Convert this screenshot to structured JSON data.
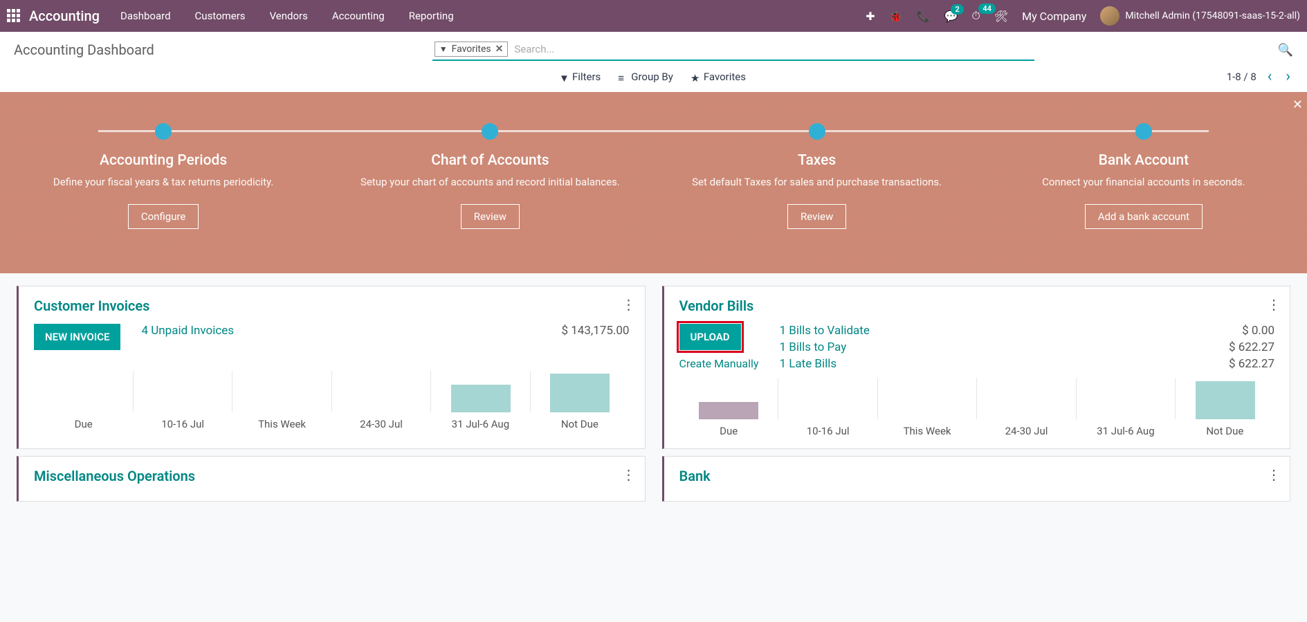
{
  "nav": {
    "brand": "Accounting",
    "menu": [
      "Dashboard",
      "Customers",
      "Vendors",
      "Accounting",
      "Reporting"
    ],
    "badges": {
      "chat": "2",
      "clock": "44"
    },
    "company": "My Company",
    "user": "Mitchell Admin (17548091-saas-15-2-all)"
  },
  "subheader": {
    "title": "Accounting Dashboard",
    "chip": "Favorites",
    "search_placeholder": "Search...",
    "filters": "Filters",
    "groupby": "Group By",
    "favorites": "Favorites",
    "pager": "1-8 / 8"
  },
  "hero": {
    "steps": [
      {
        "title": "Accounting Periods",
        "desc": "Define your fiscal years & tax returns periodicity.",
        "btn": "Configure"
      },
      {
        "title": "Chart of Accounts",
        "desc": "Setup your chart of accounts and record initial balances.",
        "btn": "Review"
      },
      {
        "title": "Taxes",
        "desc": "Set default Taxes for sales and purchase transactions.",
        "btn": "Review"
      },
      {
        "title": "Bank Account",
        "desc": "Connect your financial accounts in seconds.",
        "btn": "Add a bank account"
      }
    ]
  },
  "cards": {
    "invoices": {
      "title": "Customer Invoices",
      "btn": "NEW INVOICE",
      "stat_label": "4 Unpaid Invoices",
      "stat_amount": "$ 143,175.00"
    },
    "bills": {
      "title": "Vendor Bills",
      "btn": "UPLOAD",
      "sublink": "Create Manually",
      "lines": [
        {
          "label": "1 Bills to Validate",
          "amt": "$ 0.00"
        },
        {
          "label": "1 Bills to Pay",
          "amt": "$ 622.27"
        },
        {
          "label": "1 Late Bills",
          "amt": "$ 622.27"
        }
      ]
    },
    "misc": {
      "title": "Miscellaneous Operations"
    },
    "bank": {
      "title": "Bank"
    }
  },
  "chart_data": [
    {
      "type": "bar",
      "card": "invoices",
      "categories": [
        "Due",
        "10-16 Jul",
        "This Week",
        "24-30 Jul",
        "31 Jul-6 Aug",
        "Not Due"
      ],
      "values": [
        0,
        0,
        0,
        0,
        40,
        56
      ],
      "color": "#A5D6D3",
      "ylim": [
        0,
        60
      ]
    },
    {
      "type": "bar",
      "card": "bills",
      "categories": [
        "Due",
        "10-16 Jul",
        "This Week",
        "24-30 Jul",
        "31 Jul-6 Aug",
        "Not Due"
      ],
      "values": [
        25,
        0,
        0,
        0,
        0,
        55
      ],
      "colors": [
        "#B9A5B6",
        "#A5D6D3",
        "#A5D6D3",
        "#A5D6D3",
        "#A5D6D3",
        "#A5D6D3"
      ],
      "ylim": [
        0,
        60
      ]
    }
  ]
}
